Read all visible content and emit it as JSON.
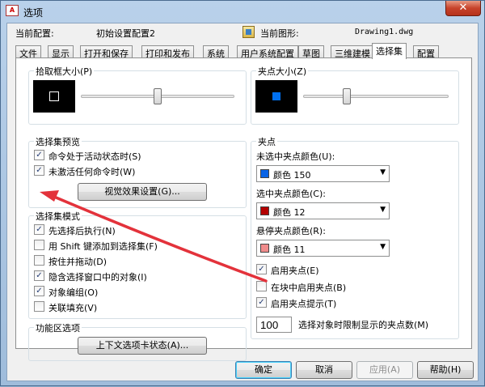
{
  "window": {
    "title": "选项",
    "app_icon_text": "A"
  },
  "header": {
    "profile_label": "当前配置:",
    "profile_value": "初始设置配置2",
    "drawing_label": "当前图形:",
    "drawing_value": "Drawing1.dwg"
  },
  "tabs": [
    {
      "label": "文件"
    },
    {
      "label": "显示"
    },
    {
      "label": "打开和保存"
    },
    {
      "label": "打印和发布"
    },
    {
      "label": "系统"
    },
    {
      "label": "用户系统配置"
    },
    {
      "label": "草图"
    },
    {
      "label": "三维建模"
    },
    {
      "label": "选择集"
    },
    {
      "label": "配置"
    }
  ],
  "active_tab": "选择集",
  "pickbox": {
    "label": "拾取框大小(P)",
    "level": 0.5
  },
  "grip_size": {
    "label": "夹点大小(Z)",
    "level": 0.3
  },
  "selection_preview": {
    "label": "选择集预览",
    "options": [
      {
        "label": "命令处于活动状态时(S)",
        "checked": true
      },
      {
        "label": "未激活任何命令时(W)",
        "checked": true
      }
    ],
    "button": "视觉效果设置(G)..."
  },
  "selection_modes": {
    "label": "选择集模式",
    "options": [
      {
        "label": "先选择后执行(N)",
        "checked": true
      },
      {
        "label": "用 Shift 键添加到选择集(F)",
        "checked": false
      },
      {
        "label": "按住并拖动(D)",
        "checked": false
      },
      {
        "label": "隐含选择窗口中的对象(I)",
        "checked": true
      },
      {
        "label": "对象编组(O)",
        "checked": true
      },
      {
        "label": "关联填充(V)",
        "checked": false
      }
    ]
  },
  "ribbon": {
    "label": "功能区选项",
    "button": "上下文选项卡状态(A)..."
  },
  "grips": {
    "label": "夹点",
    "unselected": {
      "label": "未选中夹点颜色(U):",
      "value": "颜色 150",
      "color": "#0a64e6"
    },
    "selected": {
      "label": "选中夹点颜色(C):",
      "value": "颜色 12",
      "color": "#b40000"
    },
    "hover": {
      "label": "悬停夹点颜色(R):",
      "value": "颜色 11",
      "color": "#f08c8c"
    },
    "options": [
      {
        "label": "启用夹点(E)",
        "checked": true
      },
      {
        "label": "在块中启用夹点(B)",
        "checked": false
      },
      {
        "label": "启用夹点提示(T)",
        "checked": true
      }
    ],
    "limit_value": "100",
    "limit_label": "选择对象时限制显示的夹点数(M)"
  },
  "footer": {
    "ok": "确定",
    "cancel": "取消",
    "apply": "应用(A)",
    "help": "帮助(H)"
  },
  "annotation_color": "#e3323b",
  "checkmark": "✓",
  "dropdown_arrow": "▼",
  "close_glyph": "✕"
}
